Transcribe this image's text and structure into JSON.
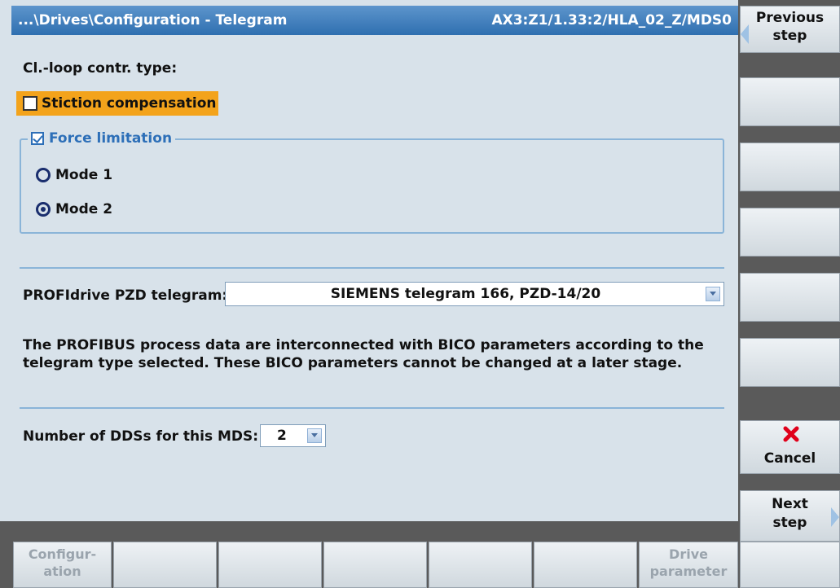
{
  "title": {
    "path": "...\\Drives\\Configuration - Telegram",
    "target": "AX3:Z1/1.33:2/HLA_02_Z/MDS0"
  },
  "form": {
    "loop_type_label": "Cl.-loop contr. type:",
    "stiction_label": "Stiction compensation",
    "stiction_checked": false,
    "force_label": "Force limitation",
    "force_checked": true,
    "modes": [
      {
        "label": "Mode 1",
        "selected": false
      },
      {
        "label": "Mode 2",
        "selected": true
      }
    ],
    "telegram_label": "PROFIdrive PZD telegram:",
    "telegram_value": "SIEMENS telegram 166, PZD-14/20",
    "info_line1": "The PROFIBUS process data are interconnected with BICO parameters according to the",
    "info_line2": "telegram type selected. These BICO parameters cannot be changed at a later stage.",
    "dds_label": "Number of DDSs for this MDS:",
    "dds_value": "2"
  },
  "softkeys_right": {
    "previous_line1": "Previous",
    "previous_line2": "step",
    "cancel": "Cancel",
    "next_line1": "Next",
    "next_line2": "step"
  },
  "softkeys_bottom": {
    "configuration_line1": "Configur-",
    "configuration_line2": "ation",
    "drive_param_line1": "Drive",
    "drive_param_line2": "parameter"
  },
  "colors": {
    "title_bar": "#2f6fb0",
    "highlight": "#f3a31b",
    "accent": "#2d6fb8",
    "cancel_icon": "#e0001a"
  }
}
